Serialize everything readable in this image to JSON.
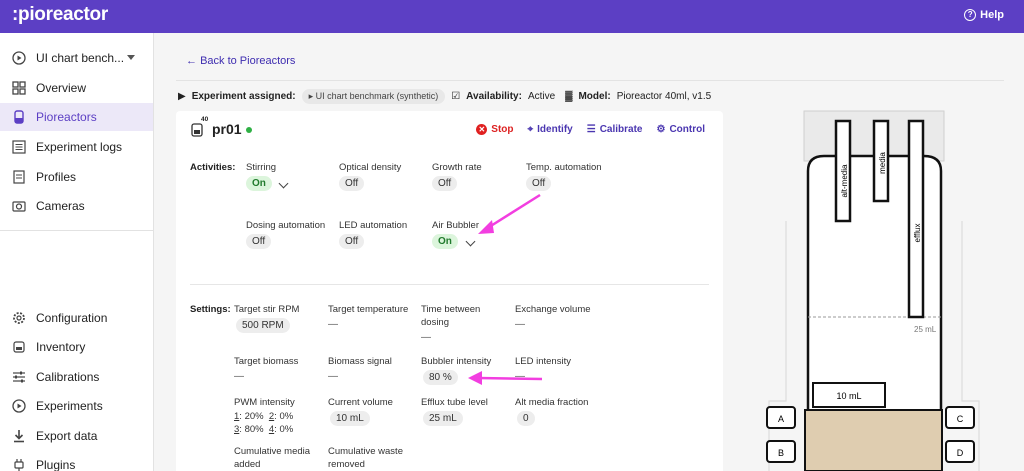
{
  "header": {
    "logo": ":pioreactor",
    "help": "Help"
  },
  "sidebar": {
    "experiment": "UI chart bench...",
    "items": [
      {
        "label": "Overview",
        "icon": "grid-icon"
      },
      {
        "label": "Pioreactors",
        "icon": "pioreactor-icon"
      },
      {
        "label": "Experiment logs",
        "icon": "list-icon"
      },
      {
        "label": "Profiles",
        "icon": "profile-icon"
      },
      {
        "label": "Cameras",
        "icon": "camera-icon"
      }
    ],
    "bottom_items": [
      {
        "label": "Configuration",
        "icon": "gear-icon"
      },
      {
        "label": "Inventory",
        "icon": "inventory-icon"
      },
      {
        "label": "Calibrations",
        "icon": "sliders-icon"
      },
      {
        "label": "Experiments",
        "icon": "play-icon"
      },
      {
        "label": "Export data",
        "icon": "download-icon"
      },
      {
        "label": "Plugins",
        "icon": "plug-icon"
      }
    ]
  },
  "main": {
    "back": "Back to Pioreactors",
    "meta": {
      "experiment_label": "Experiment assigned:",
      "experiment_value": "UI chart benchmark (synthetic)",
      "availability_label": "Availability:",
      "availability_value": "Active",
      "model_label": "Model:",
      "model_value": "Pioreactor 40ml, v1.5"
    }
  },
  "card": {
    "badge": "40",
    "unit": "pr01",
    "actions": {
      "stop": "Stop",
      "identify": "Identify",
      "calibrate": "Calibrate",
      "control": "Control"
    },
    "activities_label": "Activities:",
    "activities": {
      "stirring": {
        "label": "Stirring",
        "state": "On"
      },
      "od": {
        "label": "Optical density",
        "state": "Off"
      },
      "growth": {
        "label": "Growth rate",
        "state": "Off"
      },
      "temp": {
        "label": "Temp. automation",
        "state": "Off"
      },
      "dosing": {
        "label": "Dosing automation",
        "state": "Off"
      },
      "led": {
        "label": "LED automation",
        "state": "Off"
      },
      "bubbler": {
        "label": "Air Bubbler",
        "state": "On"
      }
    },
    "settings_label": "Settings:",
    "settings": {
      "target_rpm": {
        "label": "Target stir RPM",
        "value": "500 RPM"
      },
      "target_temp": {
        "label": "Target temperature",
        "value": "—"
      },
      "time_dosing_1": "Time between",
      "time_dosing_2": "dosing",
      "time_dosing_value": "—",
      "exchange": {
        "label": "Exchange volume",
        "value": "—"
      },
      "biomass": {
        "label": "Target biomass",
        "value": "—"
      },
      "biomass_signal": {
        "label": "Biomass signal",
        "value": "—"
      },
      "bubbler_int": {
        "label": "Bubbler intensity",
        "value": "80 %"
      },
      "led_int": {
        "label": "LED intensity",
        "value": "—"
      },
      "pwm_label": "PWM intensity",
      "pwm": {
        "c1": "1",
        "v1": ": 20%",
        "c2": "2",
        "v2": ": 0%",
        "c3": "3",
        "v3": ": 80%",
        "c4": "4",
        "v4": ": 0%"
      },
      "current_volume": {
        "label": "Current volume",
        "value": "10 mL"
      },
      "efflux": {
        "label": "Efflux tube level",
        "value": "25 mL"
      },
      "alt_media": {
        "label": "Alt media fraction",
        "value": "0"
      },
      "cum_media_1": "Cumulative media",
      "cum_media_2": "added",
      "cum_waste_1": "Cumulative waste",
      "cum_waste_2": "removed"
    }
  },
  "diagram": {
    "tubes": [
      "alt-media",
      "media",
      "efflux"
    ],
    "level_label": "25 mL",
    "volume_label": "10 mL",
    "ports": [
      "A",
      "B",
      "C",
      "D"
    ]
  },
  "colors": {
    "accent": "#5c3fc4",
    "annotation_arrow": "#f23ee0",
    "on": "#217a2d",
    "stop": "#e02020"
  }
}
